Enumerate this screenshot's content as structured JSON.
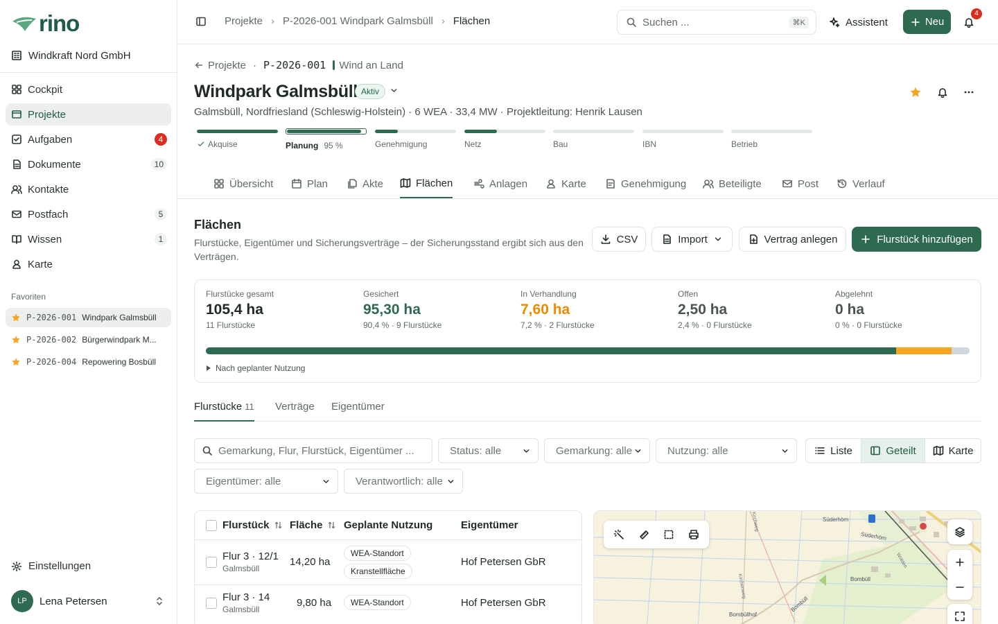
{
  "sidebar": {
    "logo_text": "rino",
    "org_name": "Windkraft Nord GmbH",
    "nav": [
      {
        "label": "Cockpit",
        "icon": "dashboard-icon"
      },
      {
        "label": "Projekte",
        "icon": "folder-icon",
        "active": true
      },
      {
        "label": "Aufgaben",
        "icon": "checkbox-icon",
        "badge": "4",
        "badge_color": "#d92d20"
      },
      {
        "label": "Dokumente",
        "icon": "document-icon",
        "badge": "10"
      },
      {
        "label": "Kontakte",
        "icon": "contacts-icon"
      },
      {
        "label": "Postfach",
        "icon": "mail-icon",
        "badge": "5"
      },
      {
        "label": "Wissen",
        "icon": "book-icon",
        "badge": "1"
      },
      {
        "label": "Karte",
        "icon": "map-pin-person-icon"
      }
    ],
    "favorites_title": "Favoriten",
    "favorites": [
      {
        "code": "P-2026-001",
        "name": "Windpark Galmsbüll",
        "active": true
      },
      {
        "code": "P-2026-002",
        "name": "Bürgerwindpark M..."
      },
      {
        "code": "P-2026-004",
        "name": "Repowering Bosbüll"
      }
    ],
    "settings_label": "Einstellungen",
    "user": {
      "initials": "LP",
      "name": "Lena Petersen"
    }
  },
  "topbar": {
    "breadcrumb": [
      "Projekte",
      "P-2026-001 Windpark Galmsbüll",
      "Flächen"
    ],
    "search_placeholder": "Suchen ...",
    "search_shortcut": "⌘K",
    "assistant_label": "Assistent",
    "new_label": "Neu",
    "notification_count": "4"
  },
  "project": {
    "back_label": "Projekte",
    "code": "P-2026-001",
    "type": "Wind an Land",
    "title": "Windpark Galmsbüll",
    "status": "Aktiv",
    "meta": "Galmsbüll, Nordfriesland (Schleswig-Holstein) · 6 WEA · 33,4 MW · Projektleitung: Henrik Lausen",
    "phases": [
      {
        "label": "Akquise",
        "progress": 1.0,
        "done": true
      },
      {
        "label": "Planung",
        "progress": 0.95,
        "current": true,
        "pct_label": "95 %"
      },
      {
        "label": "Genehmigung",
        "progress": 0.28
      },
      {
        "label": "Netz",
        "progress": 0.4
      },
      {
        "label": "Bau",
        "progress": 0
      },
      {
        "label": "IBN",
        "progress": 0
      },
      {
        "label": "Betrieb",
        "progress": 0
      }
    ],
    "tabs": [
      {
        "label": "Übersicht",
        "icon": "grid-icon"
      },
      {
        "label": "Plan",
        "icon": "calendar-icon"
      },
      {
        "label": "Akte",
        "icon": "files-icon"
      },
      {
        "label": "Flächen",
        "icon": "map-icon",
        "active": true
      },
      {
        "label": "Anlagen",
        "icon": "wind-icon"
      },
      {
        "label": "Karte",
        "icon": "map-pin-person-icon"
      },
      {
        "label": "Genehmigung",
        "icon": "approval-icon"
      },
      {
        "label": "Beteiligte",
        "icon": "users-icon"
      },
      {
        "label": "Post",
        "icon": "mail-icon"
      },
      {
        "label": "Verlauf",
        "icon": "history-icon"
      }
    ]
  },
  "section": {
    "title": "Flächen",
    "description": "Flurstücke, Eigentümer und Sicherungsverträge – der Sicherungsstand ergibt sich aus den Verträgen.",
    "buttons": {
      "csv": "CSV",
      "import": "Import",
      "contract": "Vertrag anlegen",
      "add_parcel": "Flurstück hinzufügen"
    }
  },
  "stats": [
    {
      "label": "Flurstücke gesamt",
      "value": "105,4 ha",
      "sub": "11 Flurstücke",
      "color": "#1f2a27"
    },
    {
      "label": "Gesichert",
      "value": "95,30 ha",
      "sub": "90,4 % · 9 Flurstücke",
      "color": "#2d6a4f"
    },
    {
      "label": "In Verhandlung",
      "value": "7,60 ha",
      "sub": "7,2 % · 2 Flurstücke",
      "color": "#e88b00"
    },
    {
      "label": "Offen",
      "value": "2,50 ha",
      "sub": "2,4 % · 0 Flurstücke",
      "color": "#4a5551"
    },
    {
      "label": "Abgelehnt",
      "value": "0 ha",
      "sub": "0 % · 0 Flurstücke",
      "color": "#4a5551"
    }
  ],
  "stats_bar": [
    {
      "share": 0.904,
      "color": "#2d6a4f"
    },
    {
      "share": 0.072,
      "color": "#f5a623"
    },
    {
      "share": 0.024,
      "color": "#cfd6dc"
    }
  ],
  "stats_toggle": "Nach geplanter Nutzung",
  "subtabs": [
    {
      "label": "Flurstücke",
      "count": "11",
      "active": true
    },
    {
      "label": "Verträge"
    },
    {
      "label": "Eigentümer"
    }
  ],
  "filters": {
    "search_placeholder": "Gemarkung, Flur, Flurstück, Eigentümer ...",
    "status": "Status: alle",
    "gemarkung": "Gemarkung: alle",
    "nutzung": "Nutzung: alle",
    "eigentuemer": "Eigentümer: alle",
    "verantwortlich": "Verantwortlich: alle",
    "views": [
      "Liste",
      "Geteilt",
      "Karte"
    ]
  },
  "table": {
    "headers": [
      "Flurstück",
      "Fläche",
      "Geplante Nutzung",
      "Eigentümer"
    ],
    "rows": [
      {
        "parcel": "Flur 3 · 12/1",
        "gemarkung": "Galmsbüll",
        "area": "14,20 ha",
        "uses": [
          "WEA-Standort",
          "Kranstellfläche"
        ],
        "owner": "Hof Petersen GbR"
      },
      {
        "parcel": "Flur 3 · 14",
        "gemarkung": "Galmsbüll",
        "area": "9,80 ha",
        "uses": [
          "WEA-Standort"
        ],
        "owner": "Hof Petersen GbR"
      }
    ]
  },
  "map": {
    "labels": [
      "Süderhörn",
      "Süderhörn",
      "Bombüll",
      "Bombüll",
      "Bombüllhof",
      "Kirchenweg",
      "Kirchweg",
      "Wolden"
    ]
  }
}
